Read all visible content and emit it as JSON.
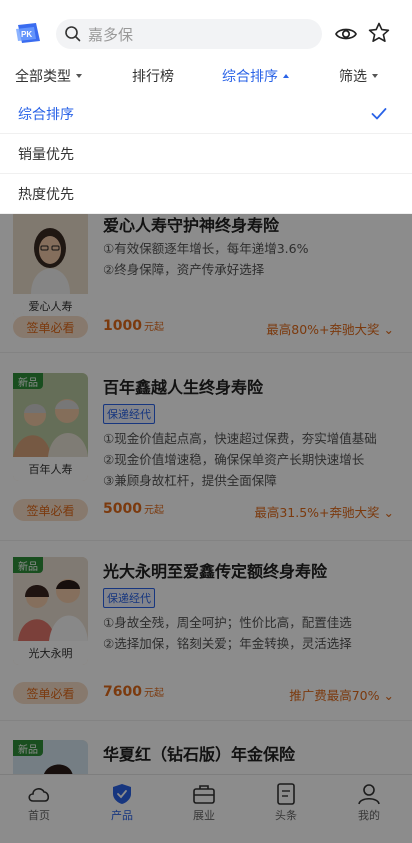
{
  "search": {
    "placeholder": "嘉多保"
  },
  "filter": {
    "items": [
      "全部类型",
      "排行榜",
      "综合排序",
      "筛选"
    ]
  },
  "dropdown": {
    "options": [
      "综合排序",
      "销量优先",
      "热度优先"
    ],
    "selected": "综合排序"
  },
  "products": [
    {
      "title": "爱心人寿守护神终身寿险",
      "thumb_caption": "爱心人寿",
      "new": false,
      "tag": "",
      "features": [
        "①有效保额逐年增长，每年递增3.6%",
        "②终身保障，资产传承好选择"
      ],
      "pill": "签单必看",
      "price": "1000",
      "price_unit": "元起",
      "reward": "最高80%+奔驰大奖"
    },
    {
      "title": "百年鑫越人生终身寿险",
      "thumb_caption": "百年人寿",
      "new": true,
      "new_label": "新品",
      "tag": "保递经代",
      "features": [
        "①现金价值起点高，快速超过保费，夯实增值基础",
        "②现金价值增速稳，确保保单资产长期快速增长",
        "③兼顾身故杠杆，提供全面保障"
      ],
      "pill": "签单必看",
      "price": "5000",
      "price_unit": "元起",
      "reward": "最高31.5%+奔驰大奖"
    },
    {
      "title": "光大永明至爱鑫传定额终身寿险",
      "thumb_caption": "光大永明",
      "new": true,
      "new_label": "新品",
      "tag": "保递经代",
      "features": [
        "①身故全残，周全呵护；性价比高，配置佳选",
        "②选择加保，铭刻关爱；年金转换，灵活选择"
      ],
      "pill": "签单必看",
      "price": "7600",
      "price_unit": "元起",
      "reward": "推广费最高70%"
    },
    {
      "title": "华夏红（钻石版）年金保险",
      "thumb_caption": "",
      "new": true,
      "new_label": "新品"
    }
  ],
  "tabbar": {
    "items": [
      "首页",
      "产品",
      "展业",
      "头条",
      "我的"
    ],
    "active": "产品"
  },
  "colors": {
    "accent": "#2a63e7",
    "orange": "#e06a1b",
    "pill_bg": "#f6dcc6",
    "new_badge": "#2f8f3a"
  }
}
